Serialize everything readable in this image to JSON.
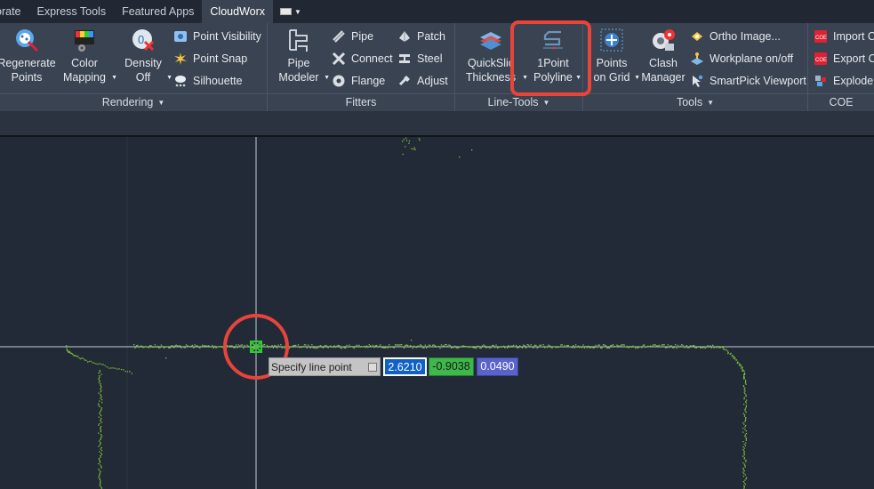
{
  "tabs": [
    {
      "label": "orate",
      "active": false
    },
    {
      "label": "Express Tools",
      "active": false
    },
    {
      "label": "Featured Apps",
      "active": false
    },
    {
      "label": "CloudWorx",
      "active": true
    }
  ],
  "panels": {
    "rendering": {
      "title": "Rendering",
      "regenerate": "Regenerate\nPoints",
      "regen_line1": "Regenerate",
      "regen_line2": "Points",
      "color_line1": "Color",
      "color_line2": "Mapping",
      "density_line1": "Density",
      "density_line2": "Off",
      "point_visibility": "Point Visibility",
      "point_snap": "Point Snap",
      "silhouette": "Silhouette"
    },
    "fitters": {
      "title": "Fitters",
      "pipe_line1": "Pipe",
      "pipe_line2": "Modeler",
      "pipe": "Pipe",
      "connect": "Connect",
      "flange": "Flange",
      "patch": "Patch",
      "steel": "Steel",
      "adjust": "Adjust"
    },
    "line_tools": {
      "title": "Line-Tools",
      "quickslice_line1": "QuickSlic",
      "quickslice_line2": "Thickness",
      "onepoint_line1": "1Point",
      "onepoint_line2": "Polyline"
    },
    "tools": {
      "title": "Tools",
      "points_line1": "Points",
      "points_line2": "on Grid",
      "clash_line1": "Clash",
      "clash_line2": "Manager",
      "ortho": "Ortho Image...",
      "workplane": "Workplane on/off",
      "smartpick": "SmartPick Viewport"
    },
    "coe": {
      "title": "COE",
      "import": "Import C",
      "export": "Export C",
      "explode": "Explode"
    }
  },
  "prompt": {
    "label": "Specify line point",
    "x": "2.6210",
    "y": "-0.9038",
    "z": "0.0490"
  },
  "colors": {
    "accent_highlight": "#e8443a",
    "point_cloud": "#7ec23a",
    "snap_marker": "#2fcc2f",
    "coord_x": "#0f60c8",
    "coord_y": "#3eb84a",
    "coord_z": "#5a63c7"
  }
}
